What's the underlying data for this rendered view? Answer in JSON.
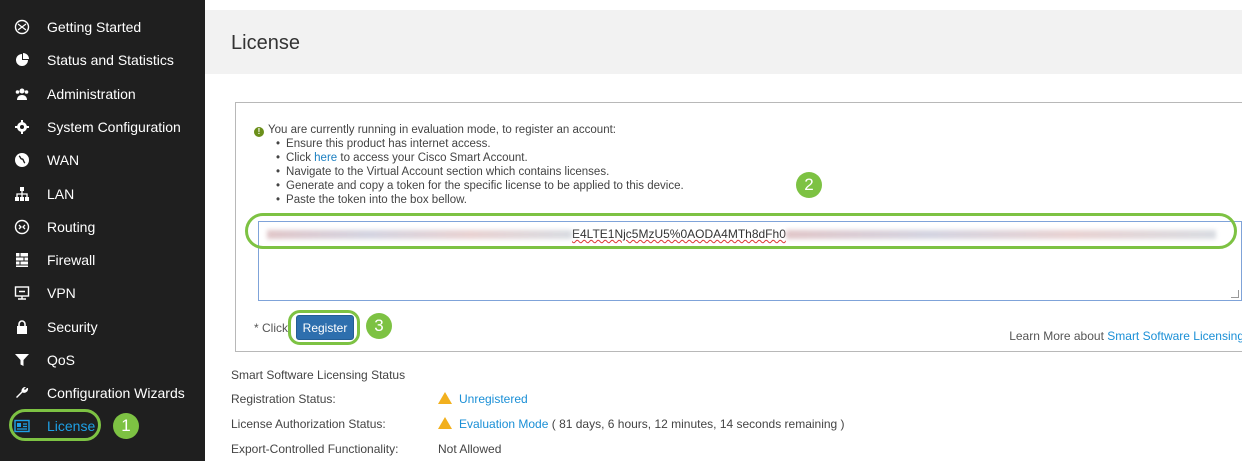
{
  "sidebar": {
    "items": [
      {
        "label": "Getting Started",
        "icon": "getting-started-icon"
      },
      {
        "label": "Status and Statistics",
        "icon": "pie-chart-icon"
      },
      {
        "label": "Administration",
        "icon": "users-icon"
      },
      {
        "label": "System Configuration",
        "icon": "gear-icon"
      },
      {
        "label": "WAN",
        "icon": "globe-icon"
      },
      {
        "label": "LAN",
        "icon": "network-icon"
      },
      {
        "label": "Routing",
        "icon": "routing-icon"
      },
      {
        "label": "Firewall",
        "icon": "firewall-icon"
      },
      {
        "label": "VPN",
        "icon": "monitor-icon"
      },
      {
        "label": "Security",
        "icon": "lock-icon"
      },
      {
        "label": "QoS",
        "icon": "filter-icon"
      },
      {
        "label": "Configuration Wizards",
        "icon": "wrench-icon"
      },
      {
        "label": "License",
        "icon": "license-card-icon",
        "active": true
      }
    ]
  },
  "page": {
    "title": "License"
  },
  "notice": {
    "intro": "You are currently running in evaluation mode, to register an account:",
    "steps": [
      "Ensure this product has internet access.",
      "Navigate to the Virtual Account section which contains licenses.",
      "Generate and copy a token for the specific license to be applied to this device.",
      "Paste the token into the box bellow."
    ],
    "click_prefix": "Click",
    "click_link": "here",
    "click_suffix": "to access your Cisco Smart Account."
  },
  "token": {
    "visible_fragment": "E4LTE1Njc5MzU5%0AODA4MTh8dFh0"
  },
  "register": {
    "click_text": "* Click",
    "button_label": "Register"
  },
  "learn_more": {
    "prefix": "Learn More about",
    "link": "Smart Software Licensing"
  },
  "status": {
    "title": "Smart Software Licensing Status",
    "rows": [
      {
        "key": "Registration Status:",
        "value": "Unregistered"
      },
      {
        "key": "License Authorization Status:",
        "value": "Evaluation Mode",
        "extra": "( 81 days, 6 hours, 12 minutes, 14 seconds remaining )"
      },
      {
        "key": "Export-Controlled Functionality:",
        "value": "Not Allowed"
      }
    ]
  },
  "annotations": [
    "1",
    "2",
    "3"
  ],
  "colors": {
    "sidebar_bg": "#1f1f1f",
    "accent": "#1ea0e6",
    "annotation_green": "#7dc243",
    "button_blue": "#2e6fae",
    "warning_yellow": "#f2b01e"
  }
}
